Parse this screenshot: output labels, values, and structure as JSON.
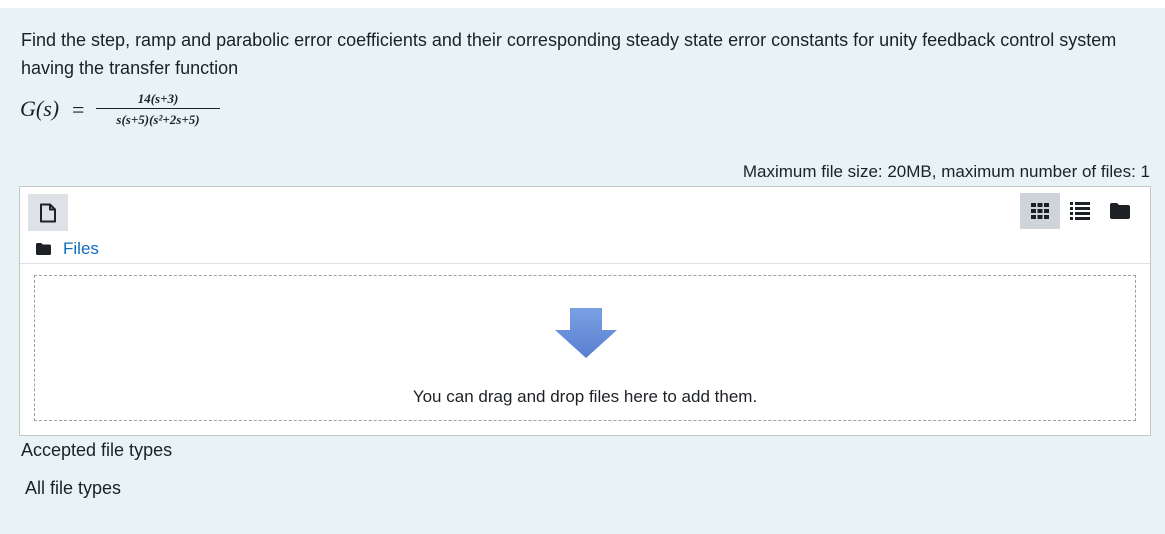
{
  "question": {
    "text": "Find the step, ramp and parabolic error coefficients and their corresponding steady state error constants for unity feedback control system having the transfer function"
  },
  "formula": {
    "lhs_symbol": "G",
    "lhs_arg": "(s)",
    "equals": "=",
    "numerator": "14(s+3)",
    "denominator": "s(s+5)(s²+2s+5)"
  },
  "file_manager": {
    "max_info": "Maximum file size: 20MB, maximum number of files: 1",
    "add_icon": "file-icon",
    "view_icons": [
      "grid-icon",
      "list-icon",
      "folder-icon"
    ],
    "breadcrumb_icon": "folder-icon",
    "breadcrumb_label": "Files",
    "drop_message": "You can drag and drop files here to add them.",
    "drop_icon": "arrow-down-icon"
  },
  "accepted": {
    "label": "Accepted file types",
    "value": "All file types"
  },
  "colors": {
    "panel_bg": "#e7f3f5",
    "link": "#0f6cbf",
    "arrow": "#6b8fd6"
  }
}
